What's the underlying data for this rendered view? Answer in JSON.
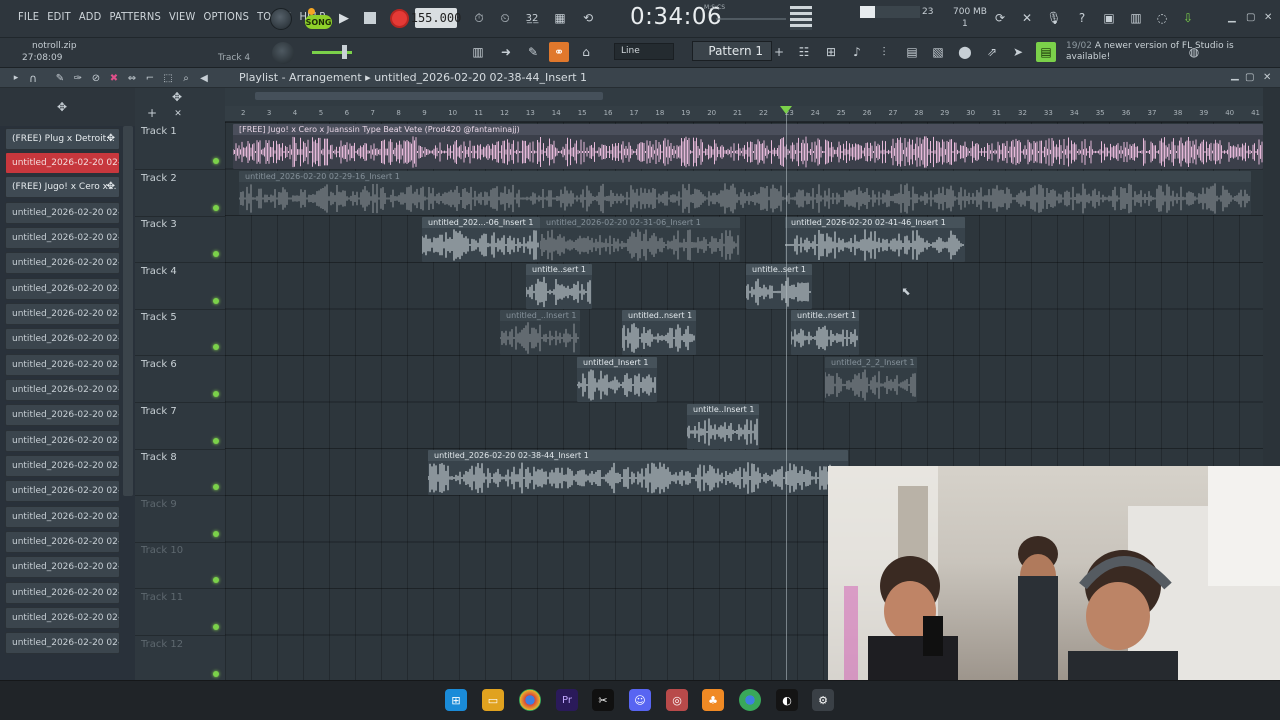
{
  "menu": [
    "FILE",
    "EDIT",
    "ADD",
    "PATTERNS",
    "VIEW",
    "OPTIONS",
    "TOOLS",
    "HELP"
  ],
  "transport": {
    "mode_label": "SONG",
    "tempo": "155.000",
    "time": "0:34:06",
    "time_label": "M:S:CS"
  },
  "monitor": {
    "cpu_label": "23",
    "memory": "700 MB",
    "voices": "1"
  },
  "hint": {
    "file": "notroll.zip",
    "time": "27:08:09",
    "track": "Track 4"
  },
  "snap": "Line",
  "pattern": "Pattern 1",
  "news": {
    "date": "19/02",
    "text": "A newer version of FL Studio is available!"
  },
  "playlist": {
    "title": "Playlist - Arrangement",
    "crumb": "untitled_2026-02-20 02-38-44_Insert 1"
  },
  "browser_items": [
    "(FREE) Plug x Detroit...",
    "untitled_2026-02-20 02-...",
    "(FREE) Jugo! x Cero x...",
    "untitled_2026-02-20 02-...",
    "untitled_2026-02-20 02-...",
    "untitled_2026-02-20 02-...",
    "untitled_2026-02-20 02-...",
    "untitled_2026-02-20 02-...",
    "untitled_2026-02-20 02-...",
    "untitled_2026-02-20 02-...",
    "untitled_2026-02-20 02-...",
    "untitled_2026-02-20 02-...",
    "untitled_2026-02-20 02-...",
    "untitled_2026-02-20 02-...",
    "untitled_2026-02-20 02-...",
    "untitled_2026-02-20 02-...",
    "untitled_2026-02-20 02-...",
    "untitled_2026-02-20 02-...",
    "untitled_2026-02-20 02-...",
    "untitled_2026-02-20 02-...",
    "untitled_2026-02-20 02-..."
  ],
  "tracks": [
    "Track 1",
    "Track 2",
    "Track 3",
    "Track 4",
    "Track 5",
    "Track 6",
    "Track 7",
    "Track 8",
    "Track 9",
    "Track 10",
    "Track 11",
    "Track 12"
  ],
  "ruler": [
    "2",
    "3",
    "4",
    "5",
    "6",
    "7",
    "8",
    "9",
    "10",
    "11",
    "12",
    "13",
    "14",
    "15",
    "16",
    "17",
    "18",
    "19",
    "20",
    "21",
    "22",
    "23",
    "24",
    "25",
    "26",
    "27",
    "28",
    "29",
    "30",
    "31",
    "32",
    "33",
    "34",
    "35",
    "36",
    "37",
    "38",
    "39",
    "40",
    "41"
  ],
  "clips": [
    {
      "track": 1,
      "label": "[FREE] Jugo! x Cero x Juanssin Type Beat Vete (Prod420 @fantaminajj)",
      "style": "pink"
    },
    {
      "track": 2,
      "label": "untitled_2026-02-20 02-29-16_Insert 1",
      "style": "mute"
    },
    {
      "track": 3,
      "label": "untitled_202...-06_Insert 1",
      "style": "norm"
    },
    {
      "track": 3,
      "label": "untitled_2026-02-20 02-31-06_Insert 1",
      "style": "mute"
    },
    {
      "track": 3,
      "label": "untitled_2026-02-20 02-41-46_Insert 1",
      "style": "norm"
    },
    {
      "track": 4,
      "label": "untitle..sert 1",
      "style": "norm"
    },
    {
      "track": 4,
      "label": "untitle..sert 1",
      "style": "norm"
    },
    {
      "track": 5,
      "label": "untitled_..Insert 1",
      "style": "mute"
    },
    {
      "track": 5,
      "label": "untitled..nsert 1",
      "style": "norm"
    },
    {
      "track": 5,
      "label": "untitle..nsert 1",
      "style": "norm"
    },
    {
      "track": 6,
      "label": "untitled_Insert 1",
      "style": "norm"
    },
    {
      "track": 6,
      "label": "untitled_2_2_Insert 1",
      "style": "mute"
    },
    {
      "track": 7,
      "label": "untitle..Insert 1",
      "style": "norm"
    },
    {
      "track": 8,
      "label": "untitled_2026-02-20 02-38-44_Insert 1",
      "style": "norm"
    }
  ],
  "colors": {
    "accent": "#7bd14a",
    "record": "#e43a36",
    "selected_clip": "#c7373d",
    "song_mode": "#8fd12a"
  }
}
